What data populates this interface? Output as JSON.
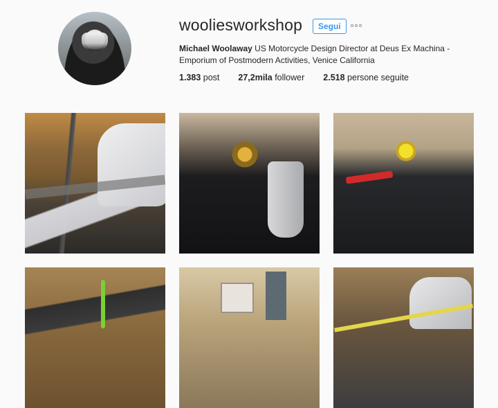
{
  "profile": {
    "username": "wooliesworkshop",
    "follow_label": "Segui",
    "bio_name": "Michael Woolaway",
    "bio_text": " US Motorcycle Design Director at Deus Ex Machina - Emporium of Postmodern Activities, Venice California"
  },
  "stats": {
    "posts_count": "1.383",
    "posts_label": " post",
    "followers_count": "27,2mila",
    "followers_label": " follower",
    "following_count": "2.518",
    "following_label": " persone seguite"
  },
  "colors": {
    "accent": "#3897f0",
    "background": "#fafafa"
  },
  "icons": {
    "more": "more-options-icon"
  }
}
